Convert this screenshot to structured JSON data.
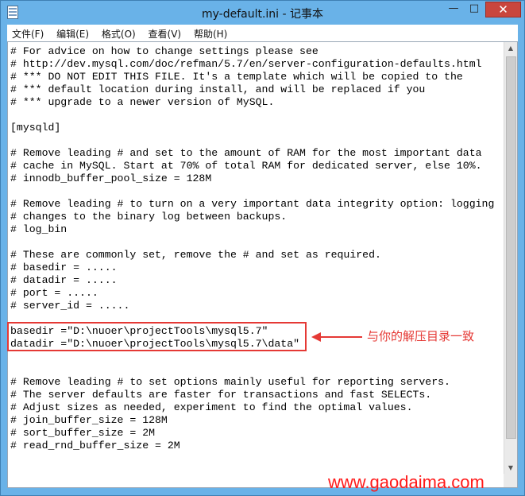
{
  "window": {
    "title": "my-default.ini - 记事本"
  },
  "controls": {
    "minimize": "—",
    "maximize": "□",
    "close": "✕"
  },
  "menu": [
    "文件(F)",
    "编辑(E)",
    "格式(O)",
    "查看(V)",
    "帮助(H)"
  ],
  "editor_lines": [
    "# For advice on how to change settings please see",
    "# http://dev.mysql.com/doc/refman/5.7/en/server-configuration-defaults.html",
    "# *** DO NOT EDIT THIS FILE. It's a template which will be copied to the",
    "# *** default location during install, and will be replaced if you",
    "# *** upgrade to a newer version of MySQL.",
    "",
    "[mysqld]",
    "",
    "# Remove leading # and set to the amount of RAM for the most important data",
    "# cache in MySQL. Start at 70% of total RAM for dedicated server, else 10%.",
    "# innodb_buffer_pool_size = 128M",
    "",
    "# Remove leading # to turn on a very important data integrity option: logging",
    "# changes to the binary log between backups.",
    "# log_bin",
    "",
    "# These are commonly set, remove the # and set as required.",
    "# basedir = .....",
    "# datadir = .....",
    "# port = .....",
    "# server_id = .....",
    "",
    "basedir =\"D:\\nuoer\\projectTools\\mysql5.7\"",
    "datadir =\"D:\\nuoer\\projectTools\\mysql5.7\\data\"",
    "",
    "",
    "# Remove leading # to set options mainly useful for reporting servers.",
    "# The server defaults are faster for transactions and fast SELECTs.",
    "# Adjust sizes as needed, experiment to find the optimal values.",
    "# join_buffer_size = 128M",
    "# sort_buffer_size = 2M",
    "# read_rnd_buffer_size = 2M"
  ],
  "annotation": {
    "text": "与你的解压目录一致"
  },
  "watermark": {
    "text": "www.gaodaima.com"
  },
  "colors": {
    "annotation": "#e53935",
    "watermark": "#ff1a1a",
    "titlebar": "#69b2e8"
  }
}
